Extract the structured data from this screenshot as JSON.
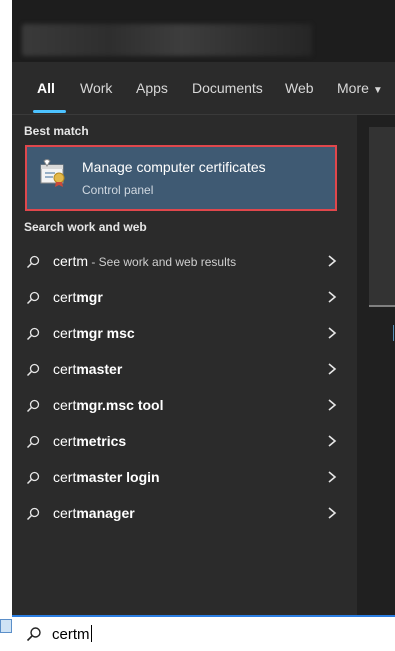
{
  "tabs": [
    {
      "label": "All"
    },
    {
      "label": "Work"
    },
    {
      "label": "Apps"
    },
    {
      "label": "Documents"
    },
    {
      "label": "Web"
    },
    {
      "label": "More"
    }
  ],
  "best_match": {
    "section_label": "Best match",
    "title": "Manage computer certificates",
    "subtitle": "Control panel",
    "icon": "certificate-manager-icon"
  },
  "search_section_label": "Search work and web",
  "results": [
    {
      "typed": "certm",
      "rest": "",
      "hint": " - See work and web results"
    },
    {
      "typed": "cert",
      "rest": "mgr",
      "hint": ""
    },
    {
      "typed": "cert",
      "rest": "mgr msc",
      "hint": ""
    },
    {
      "typed": "cert",
      "rest": "master",
      "hint": ""
    },
    {
      "typed": "cert",
      "rest": "mgr.msc tool",
      "hint": ""
    },
    {
      "typed": "cert",
      "rest": "metrics",
      "hint": ""
    },
    {
      "typed": "cert",
      "rest": "master login",
      "hint": ""
    },
    {
      "typed": "cert",
      "rest": "manager",
      "hint": ""
    }
  ],
  "search": {
    "value": "certm"
  },
  "colors": {
    "accent": "#4cc2ff",
    "selection": "#3f5a73",
    "highlight_box": "#e0474c"
  }
}
